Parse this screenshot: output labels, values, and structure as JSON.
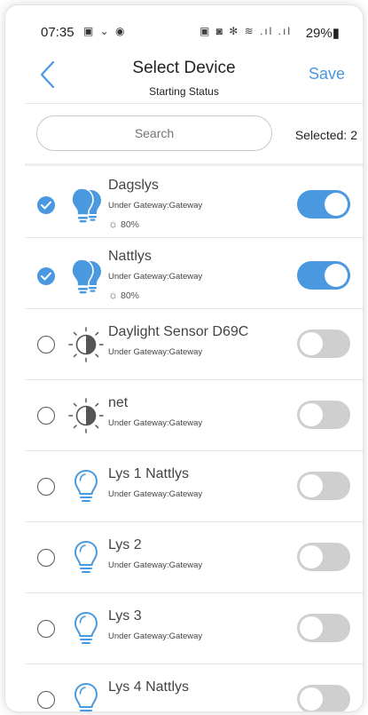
{
  "status_bar": {
    "time": "07:35",
    "left_icons": "▣ ⌄ ◉",
    "right_icons": "▣ ◙ ✻ ≋ .ıl .ıl",
    "battery": "29%▮"
  },
  "header": {
    "title": "Select Device",
    "subtitle": "Starting Status",
    "save_label": "Save"
  },
  "search": {
    "placeholder": "Search"
  },
  "selection": {
    "label": "Selected:",
    "count": "2"
  },
  "colors": {
    "accent": "#4a98e0",
    "toggle_off": "#cfcfcf"
  },
  "devices": [
    {
      "name": "Dagslys",
      "sub": "Under Gateway:Gateway",
      "brightness": "80%",
      "icon": "double-bulb-icon",
      "selected": true,
      "on": true
    },
    {
      "name": "Nattlys",
      "sub": "Under Gateway:Gateway",
      "brightness": "80%",
      "icon": "double-bulb-icon",
      "selected": true,
      "on": true
    },
    {
      "name": "Daylight Sensor D69C",
      "sub": "Under Gateway:Gateway",
      "icon": "daylight-sensor-icon",
      "selected": false,
      "on": false
    },
    {
      "name": "net",
      "sub": "Under Gateway:Gateway",
      "icon": "daylight-sensor-icon",
      "selected": false,
      "on": false
    },
    {
      "name": "Lys 1 Nattlys",
      "sub": "Under Gateway:Gateway",
      "icon": "light-bulb-icon",
      "selected": false,
      "on": false
    },
    {
      "name": "Lys 2",
      "sub": "Under Gateway:Gateway",
      "icon": "light-bulb-icon",
      "selected": false,
      "on": false
    },
    {
      "name": "Lys 3",
      "sub": "Under Gateway:Gateway",
      "icon": "light-bulb-icon",
      "selected": false,
      "on": false
    },
    {
      "name": "Lys 4 Nattlys",
      "sub": "",
      "icon": "light-bulb-icon",
      "selected": false,
      "on": false
    }
  ]
}
